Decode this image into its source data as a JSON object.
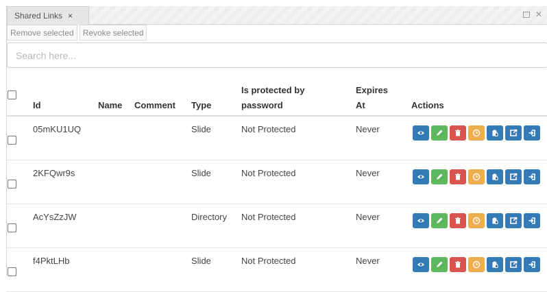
{
  "tab": {
    "title": "Shared Links",
    "close_glyph": "×"
  },
  "window": {
    "close_glyph": "✕"
  },
  "toolbar": {
    "remove_selected": "Remove selected",
    "revoke_selected": "Revoke selected"
  },
  "search": {
    "placeholder": "Search here..."
  },
  "table": {
    "headers": {
      "id": "Id",
      "name": "Name",
      "comment": "Comment",
      "type": "Type",
      "protected_line1": "Is protected by",
      "protected_line2": "password",
      "expires_line1": "Expires",
      "expires_line2": "At",
      "actions": "Actions"
    },
    "rows": [
      {
        "id": "05mKU1UQ",
        "name": "",
        "comment": "",
        "type": "Slide",
        "protected": "Not Protected",
        "expires": "Never"
      },
      {
        "id": "2KFQwr9s",
        "name": "",
        "comment": "",
        "type": "Slide",
        "protected": "Not Protected",
        "expires": "Never"
      },
      {
        "id": "AcYsZzJW",
        "name": "",
        "comment": "",
        "type": "Directory",
        "protected": "Not Protected",
        "expires": "Never"
      },
      {
        "id": "f4PktLHb",
        "name": "",
        "comment": "",
        "type": "Slide",
        "protected": "Not Protected",
        "expires": "Never"
      }
    ]
  },
  "action_buttons": [
    {
      "name": "view-button",
      "icon": "eye-icon",
      "color": "#337ab7"
    },
    {
      "name": "edit-button",
      "icon": "pencil-icon",
      "color": "#5cb85c"
    },
    {
      "name": "delete-button",
      "icon": "trash-icon",
      "color": "#d9534f"
    },
    {
      "name": "expiry-button",
      "icon": "clock-icon",
      "color": "#f0ad4e"
    },
    {
      "name": "copy-link-button",
      "icon": "clipboard-icon",
      "color": "#337ab7"
    },
    {
      "name": "open-link-button",
      "icon": "external-link-icon",
      "color": "#337ab7"
    },
    {
      "name": "sign-in-button",
      "icon": "sign-in-icon",
      "color": "#337ab7"
    }
  ]
}
